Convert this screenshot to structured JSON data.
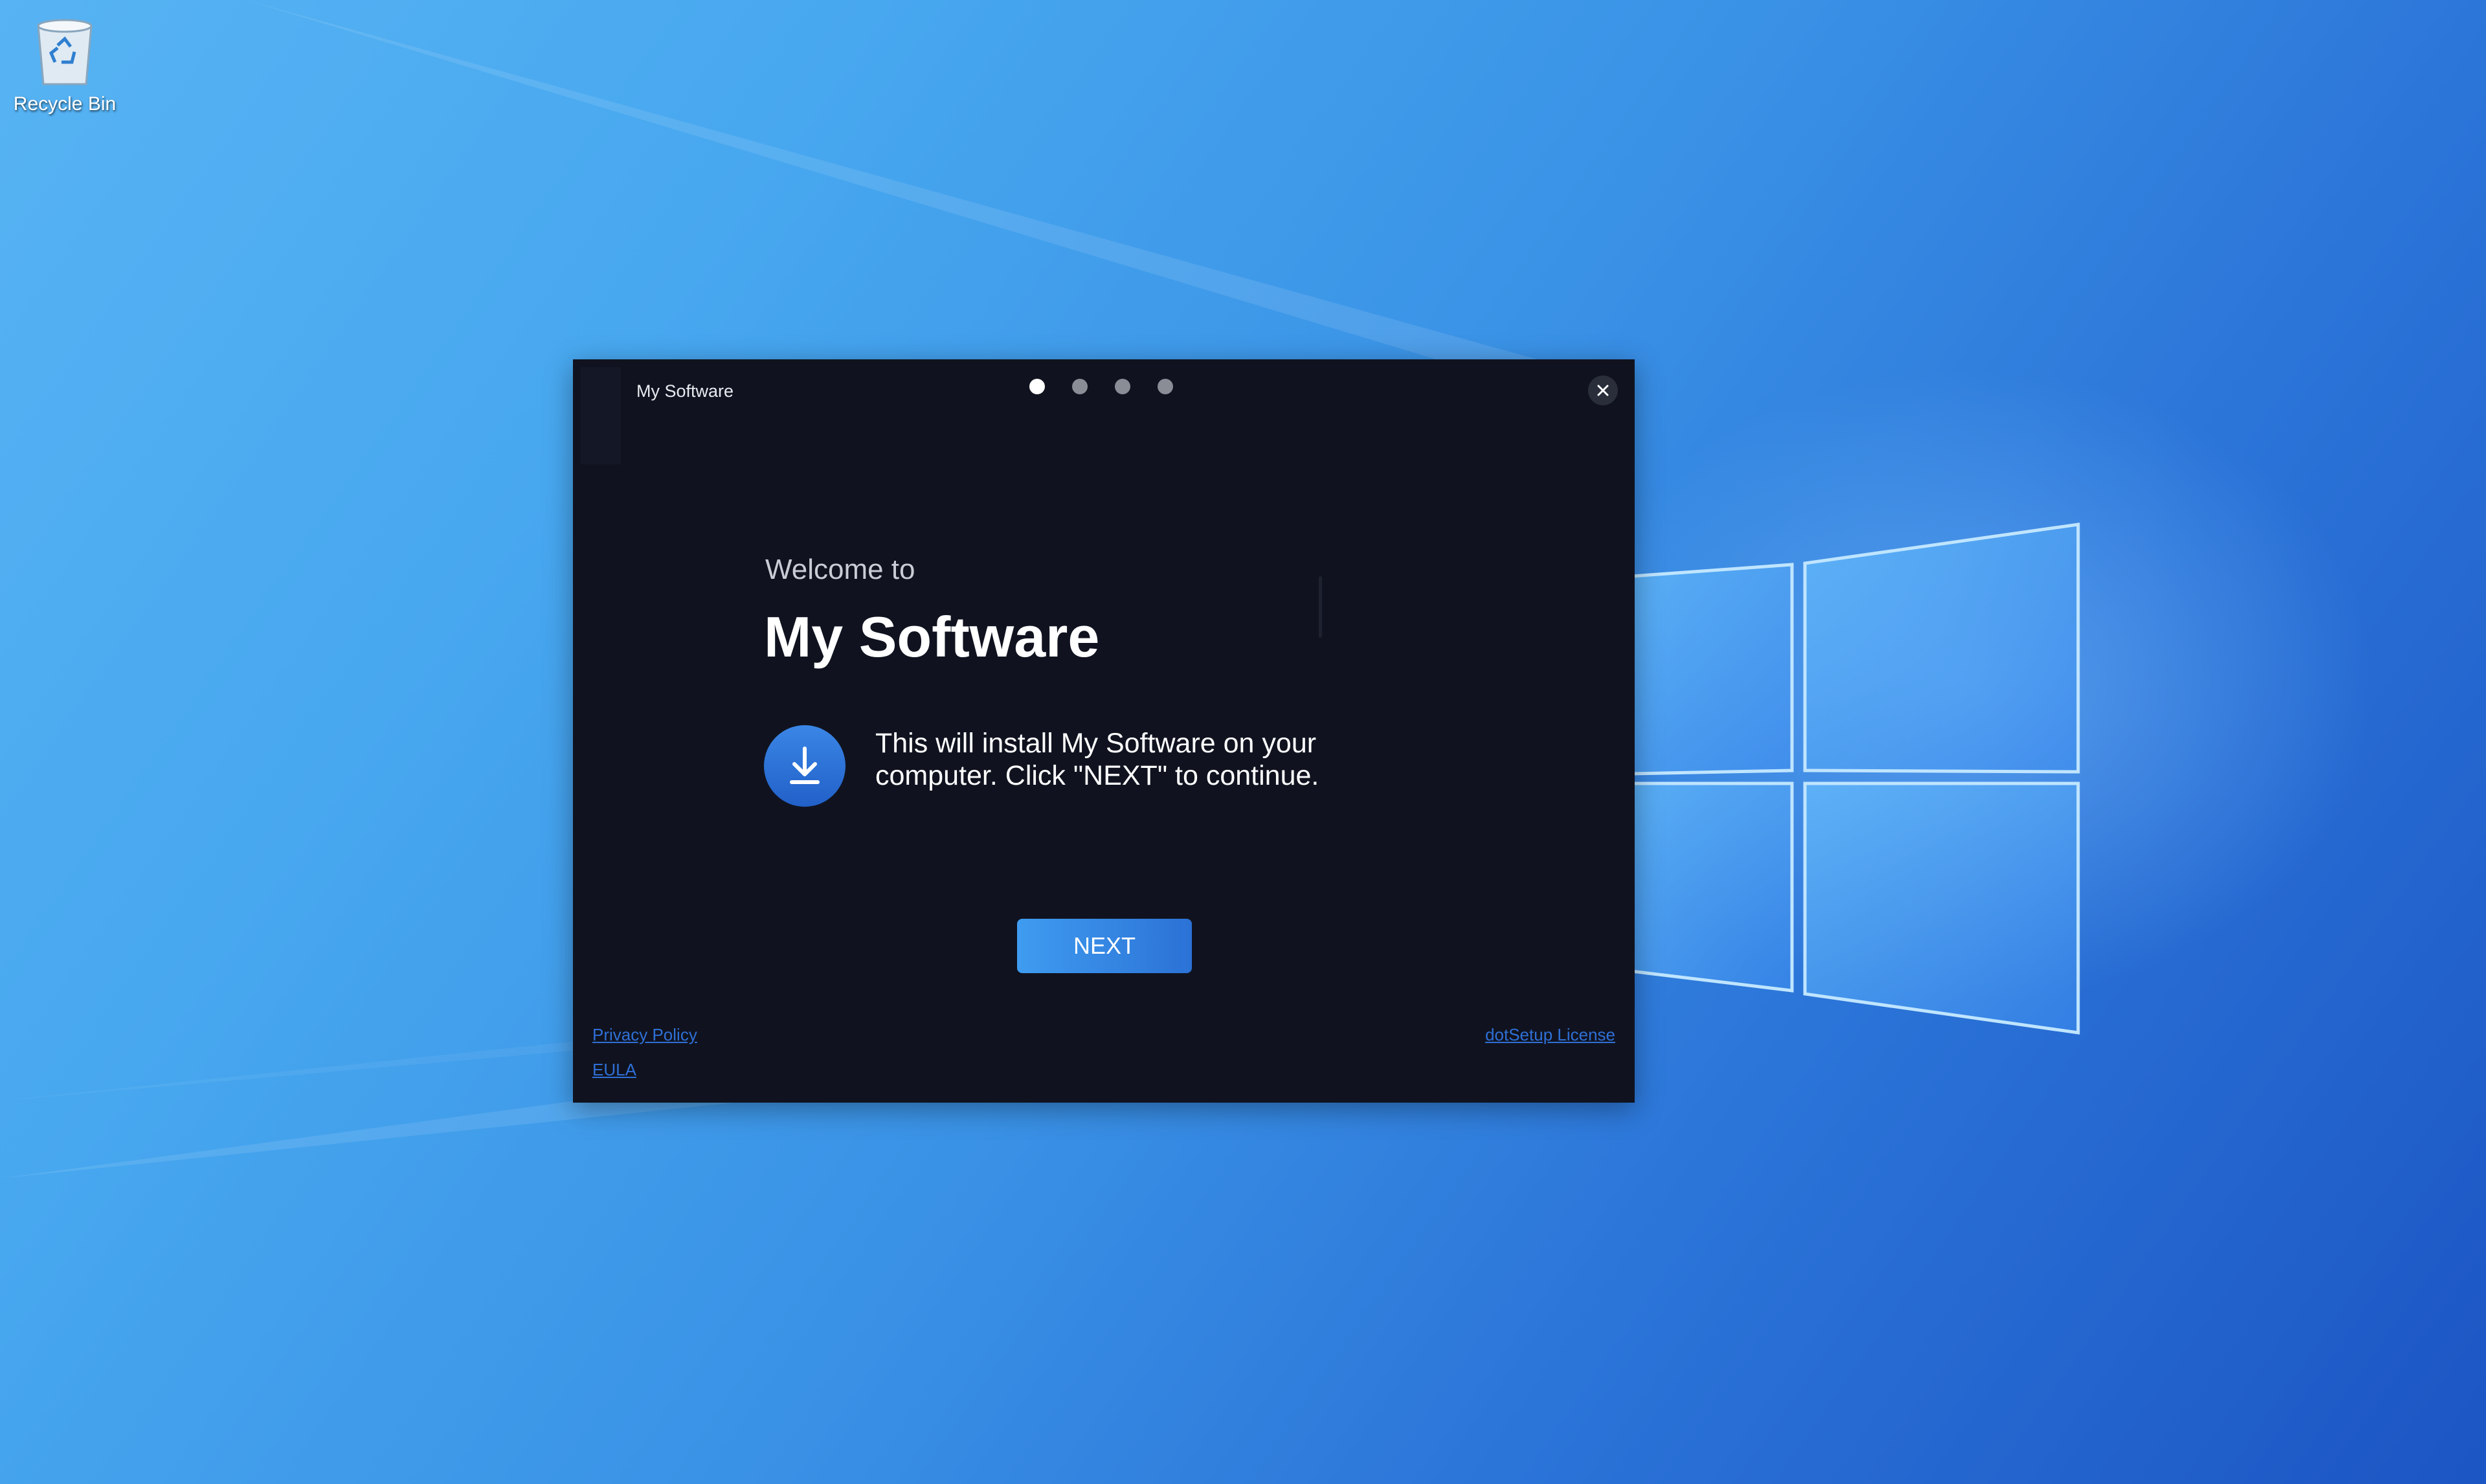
{
  "desktop": {
    "icons": [
      {
        "label": "Recycle Bin",
        "icon": "recycle-bin-icon"
      }
    ]
  },
  "installer": {
    "title": "My Software",
    "steps": {
      "total": 4,
      "current": 1
    },
    "welcome": "Welcome to",
    "product_name": "My Software",
    "install_icon": "download-icon",
    "description": "This will install My Software on your computer. Click \"NEXT\" to continue.",
    "next_label": "NEXT",
    "links": {
      "privacy": "Privacy Policy",
      "eula": "EULA",
      "license": "dotSetup License"
    }
  },
  "colors": {
    "window_bg": "#10131f",
    "accent": "#2b72d6",
    "link": "#2f6fd6",
    "desktop_light": "#57b3f3",
    "desktop_dark": "#1c55c4"
  }
}
